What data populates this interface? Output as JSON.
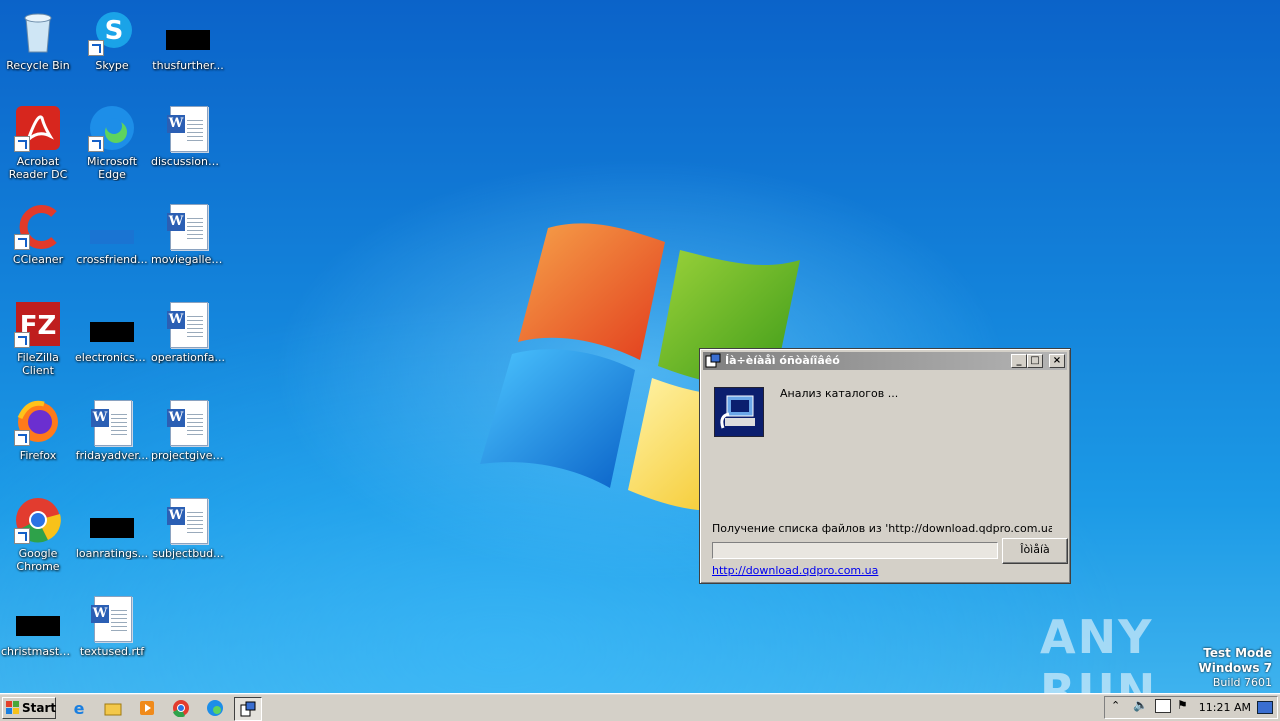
{
  "desktop": {
    "icons": [
      {
        "label": "Recycle Bin",
        "icon": "recycle-bin-icon"
      },
      {
        "label": "Skype",
        "icon": "skype-icon"
      },
      {
        "label": "thusfurther...",
        "icon": "redacted-icon"
      },
      {
        "label": "Acrobat Reader DC",
        "icon": "acrobat-icon"
      },
      {
        "label": "Microsoft Edge",
        "icon": "edge-icon"
      },
      {
        "label": "discussionm...",
        "icon": "word-document-icon"
      },
      {
        "label": "CCleaner",
        "icon": "ccleaner-icon"
      },
      {
        "label": "crossfriend...",
        "icon": "folder-icon"
      },
      {
        "label": "moviegaller...",
        "icon": "word-document-icon"
      },
      {
        "label": "FileZilla Client",
        "icon": "filezilla-icon"
      },
      {
        "label": "electronicsp...",
        "icon": "redacted-icon"
      },
      {
        "label": "operationfa...",
        "icon": "word-document-icon"
      },
      {
        "label": "Firefox",
        "icon": "firefox-icon"
      },
      {
        "label": "fridayadver...",
        "icon": "word-document-icon"
      },
      {
        "label": "projectgive.rtf",
        "icon": "word-document-icon"
      },
      {
        "label": "Google Chrome",
        "icon": "chrome-icon"
      },
      {
        "label": "loanratings...",
        "icon": "redacted-icon"
      },
      {
        "label": "subjectbud...",
        "icon": "word-document-icon"
      },
      {
        "label": "christmasth...",
        "icon": "redacted-icon"
      },
      {
        "label": "textused.rtf",
        "icon": "word-document-icon"
      }
    ]
  },
  "dialog": {
    "title": "Íà÷èíàåì óñòàíîâêó",
    "message": "Анализ каталогов ...",
    "status": "Получение списка файлов из 'http://download.qdpro.com.ua/data...",
    "progress": 0,
    "cancel_label": "Îòìåíà",
    "link": "http://download.qdpro.com.ua",
    "minimize": "_",
    "maximize": "□",
    "close": "×"
  },
  "taskbar": {
    "start_label": "Start",
    "clock": "11:21 AM",
    "pinned": [
      "internet-explorer-icon",
      "explorer-icon",
      "media-player-icon",
      "chrome-icon",
      "edge-icon",
      "installer-icon"
    ]
  },
  "watermark": {
    "line1": "Test Mode",
    "line2": "Windows 7",
    "line3": "Build 7601",
    "brand": "ANY RUN"
  }
}
